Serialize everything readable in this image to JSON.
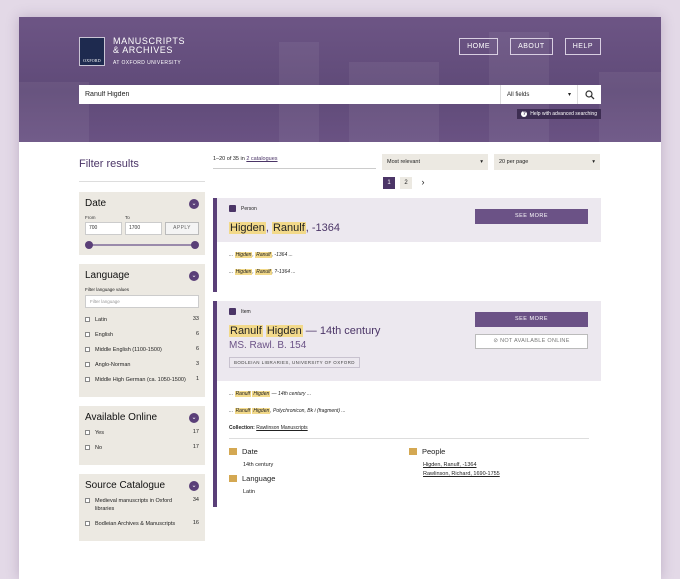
{
  "header": {
    "logo_crest_text": "OXFORD",
    "logo_line1": "MANUSCRIPTS",
    "logo_line2": "& ARCHIVES",
    "logo_sub": "AT OXFORD UNIVERSITY",
    "nav": [
      "HOME",
      "ABOUT",
      "HELP"
    ],
    "search_value": "Ranulf Higden",
    "field_select": "All fields",
    "help_link": "Help with advanced searching"
  },
  "filters": {
    "title": "Filter results",
    "date": {
      "label": "Date",
      "from_label": "From",
      "to_label": "To",
      "from_value": "700",
      "to_value": "1700",
      "apply": "APPLY",
      "range_fraction": [
        0.0,
        1.0
      ]
    },
    "language": {
      "label": "Language",
      "filter_label": "Filter language values",
      "filter_placeholder": "Filter language",
      "options": [
        {
          "name": "Latin",
          "count": "33"
        },
        {
          "name": "English",
          "count": "6"
        },
        {
          "name": "Middle English (1100-1500)",
          "count": "6"
        },
        {
          "name": "Anglo-Norman",
          "count": "3"
        },
        {
          "name": "Middle High German (ca. 1050-1500)",
          "count": "1"
        }
      ]
    },
    "online": {
      "label": "Available Online",
      "options": [
        {
          "name": "Yes",
          "count": "17"
        },
        {
          "name": "No",
          "count": "17"
        }
      ]
    },
    "catalogue": {
      "label": "Source Catalogue",
      "options": [
        {
          "name": "Medieval manuscripts in Oxford libraries",
          "count": "34"
        },
        {
          "name": "Bodleian Archives & Manuscripts",
          "count": "16"
        }
      ]
    }
  },
  "results": {
    "count_prefix": "1–20 of 35 in ",
    "count_link": "2 catalogues",
    "sort": "Most relevant",
    "per_page": "20 per page",
    "pages": [
      "1",
      "2"
    ],
    "next": "›",
    "person": {
      "kind": "Person",
      "title_hl1": "Higden",
      "title_sep": ", ",
      "title_hl2": "Ranulf",
      "title_rest": ", -1364",
      "see_more": "SEE MORE",
      "snippets": [
        {
          "pre": "... ",
          "hl1": "Higden",
          "mid": ", ",
          "hl2": "Ranulf",
          "post": ", -1364 ..."
        },
        {
          "pre": "... ",
          "hl1": "Higden",
          "mid": ", ",
          "hl2": "Ranulf",
          "post": ", ?-1364 ..."
        }
      ]
    },
    "item": {
      "kind": "Item",
      "title_hl1": "Ranulf",
      "title_sep": " ",
      "title_hl2": "Higden",
      "title_rest": " — 14th century",
      "shelfmark": "MS. Rawl. B. 154",
      "library": "BODLEIAN LIBRARIES, UNIVERSITY OF OXFORD",
      "see_more": "SEE MORE",
      "not_available": "NOT AVAILABLE ONLINE",
      "snippets": [
        {
          "pre": "... ",
          "hl1": "Ranulf",
          "mid": " ",
          "hl2": "Higden",
          "post": " — 14th century ..."
        },
        {
          "pre": "... ",
          "hl1": "Ranulf",
          "mid": " ",
          "hl2": "Higden",
          "post": ", Polychronicon, Bk i (fragment) ..."
        }
      ],
      "collection_label": "Collection:",
      "collection": "Rawlinson Manuscripts",
      "date_label": "Date",
      "date_value": "14th century",
      "language_label": "Language",
      "language_value": "Latin",
      "people_label": "People",
      "people": [
        "Higden, Ranulf, -1364",
        "Rawlinson, Richard, 1690-1755"
      ]
    }
  },
  "colors": {
    "brand_purple": "#5a3f78",
    "highlight": "#f2d98a",
    "panel_beige": "#ece9e2"
  }
}
